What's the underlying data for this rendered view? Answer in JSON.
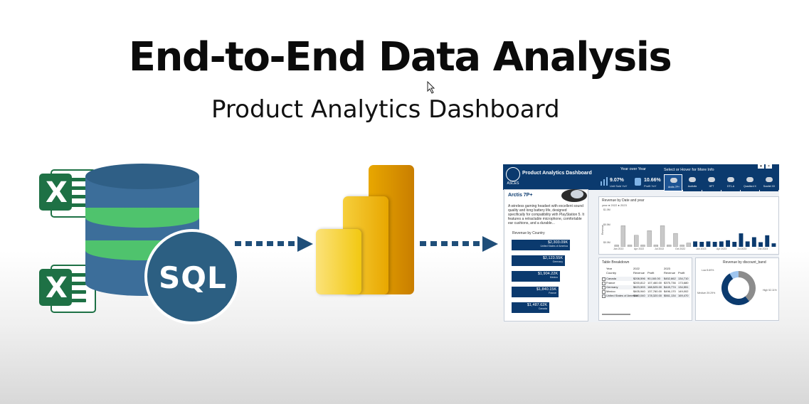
{
  "header": {
    "title": "End-to-End Data Analysis",
    "subtitle": "Product Analytics Dashboard"
  },
  "icons": {
    "excel_letter": "X",
    "sql_label": "SQL",
    "excel-icon": "excel-icon",
    "database-icon": "database-icon",
    "powerbi-icon": "power-bi-icon",
    "arrow-icon": "dotted-arrow-icon",
    "cursor-icon": "mouse-cursor-icon"
  },
  "colors": {
    "excel_green": "#1e7145",
    "db_blue": "#3c6e9a",
    "db_green": "#4fc36d",
    "sql_circle": "#2c5f82",
    "arrow_blue": "#1f4e79",
    "powerbi_dark": "#c97e00",
    "powerbi_mid": "#e8a700",
    "powerbi_light": "#f2c811",
    "dash_navy": "#0b3a6e"
  },
  "dashboard": {
    "logo_text": "ASCES",
    "title": "Product Analytics Dashboard",
    "yoy_label": "Year over Year",
    "kpis": [
      {
        "value": "9.07%",
        "label": "Unit Sold YoY"
      },
      {
        "value": "10.66%",
        "label": "Profit YoY"
      }
    ],
    "select_label": "Select or Hover for More Info",
    "products": [
      "Arctis 7P+",
      "Audioltz",
      "HFT",
      "DT1-A",
      "Quadlord X",
      "Scarlet XX"
    ],
    "product_name": "Arctis 7P+",
    "product_desc": "A wireless gaming headset with excellent sound quality and long battery life, designed specifically for compatibility with PlayStation 5. It features a retractable microphone, comfortable ear cushions, and a durable...",
    "revenue_by_country_label": "Revenue by Country",
    "countries": [
      {
        "value": "$2,303.09K",
        "name": "United States of America",
        "fraction": 1.0
      },
      {
        "value": "$2,123.55K",
        "name": "Germany",
        "fraction": 0.92
      },
      {
        "value": "$1,904.22K",
        "name": "Mexico",
        "fraction": 0.83
      },
      {
        "value": "$1,840.15K",
        "name": "France",
        "fraction": 0.8
      },
      {
        "value": "$1,487.62K",
        "name": "Canada",
        "fraction": 0.65
      }
    ],
    "chart_title": "Revenue by Date and year",
    "chart_legend": "year ● 2022 ● 2023",
    "chart_y_ticks": [
      "$1.0M",
      "$0.5M",
      "$0.0M"
    ],
    "chart_x_ticks": [
      "Jan 2022",
      "Apr 2022",
      "Jul 2022",
      "Oct 2022",
      "Jan 2023",
      "Apr 2023",
      "Jul 2023",
      "Oct 2023"
    ],
    "chart_y_label": "Revenue",
    "chart_bars": [
      {
        "year": "2022",
        "value": 0.05
      },
      {
        "year": "2022",
        "value": 0.55
      },
      {
        "year": "2022",
        "value": 0.05
      },
      {
        "year": "2022",
        "value": 0.3
      },
      {
        "year": "2022",
        "value": 0.05
      },
      {
        "year": "2022",
        "value": 0.42
      },
      {
        "year": "2022",
        "value": 0.05
      },
      {
        "year": "2022",
        "value": 0.55
      },
      {
        "year": "2022",
        "value": 0.05
      },
      {
        "year": "2022",
        "value": 0.35
      },
      {
        "year": "2022",
        "value": 0.05
      },
      {
        "year": "2022",
        "value": 0.1
      },
      {
        "year": "2023",
        "value": 0.14
      },
      {
        "year": "2023",
        "value": 0.13
      },
      {
        "year": "2023",
        "value": 0.14
      },
      {
        "year": "2023",
        "value": 0.13
      },
      {
        "year": "2023",
        "value": 0.14
      },
      {
        "year": "2023",
        "value": 0.17
      },
      {
        "year": "2023",
        "value": 0.13
      },
      {
        "year": "2023",
        "value": 0.35
      },
      {
        "year": "2023",
        "value": 0.14
      },
      {
        "year": "2023",
        "value": 0.25
      },
      {
        "year": "2023",
        "value": 0.12
      },
      {
        "year": "2023",
        "value": 0.3
      },
      {
        "year": "2023",
        "value": 0.09
      }
    ],
    "table_title": "Table Breakdown",
    "table_headers": [
      "Year",
      "2022",
      "",
      "2023",
      ""
    ],
    "table_subheaders": [
      "Country",
      "Revenue",
      "Profit",
      "Revenue",
      "Profit"
    ],
    "table_rows": [
      [
        "Canada",
        "$208,596",
        "90,160.00",
        "$452,662",
        "134,710"
      ],
      [
        "France",
        "$200,812",
        "107,460.00",
        "$375,736",
        "173,680"
      ],
      [
        "Germany",
        "$623,593",
        "188,525.00",
        "$449,774",
        "134,551"
      ],
      [
        "Mexico",
        "$405,940",
        "137,760.00",
        "$496,170",
        "149,002"
      ],
      [
        "United States of America",
        "$550,040",
        "178,320.00",
        "$561,134",
        "169,470"
      ]
    ],
    "donut_title": "Revenue by discount_band",
    "donut_labels": [
      "Low 8.69%",
      "Medium 39.29%",
      "High 52.11%"
    ],
    "donut_values": [
      8.69,
      39.29,
      52.11
    ]
  }
}
